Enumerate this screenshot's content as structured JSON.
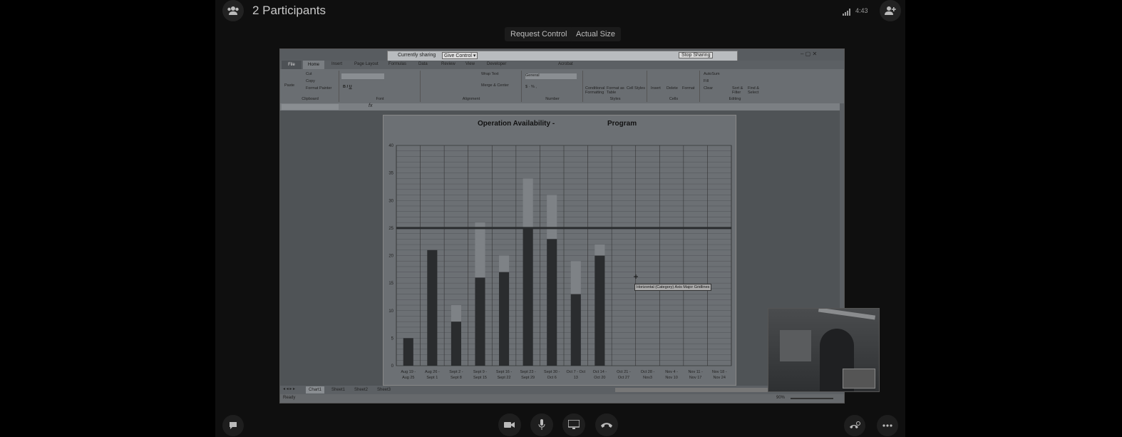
{
  "header": {
    "participants_label": "2 Participants",
    "time": "4:43",
    "participants_icon": "people-icon",
    "add_person_icon": "add-person-icon"
  },
  "toolbar": {
    "request_control": "Request Control",
    "actual_size": "Actual Size"
  },
  "share_bar": {
    "currently_sharing": "Currently sharing",
    "give_control": "Give Control ▾",
    "stop_sharing": "Stop Sharing"
  },
  "excel": {
    "tabs": [
      "File",
      "Home",
      "Insert",
      "Page Layout",
      "Formulas",
      "Data",
      "Review",
      "View",
      "Developer",
      "Acrobat"
    ],
    "groups": [
      "Clipboard",
      "Font",
      "Alignment",
      "Number",
      "Styles",
      "Cells",
      "Editing"
    ],
    "clipboard_items": [
      "Cut",
      "Copy",
      "Format Painter"
    ],
    "paste": "Paste",
    "wrap_text": "Wrap Text",
    "merge_center": "Merge & Center",
    "number_format": "General",
    "styles_items": [
      "Conditional Formatting",
      "Format as Table",
      "Cell Styles"
    ],
    "cells_items": [
      "Insert",
      "Delete",
      "Format"
    ],
    "editing_items": [
      "AutoSum",
      "Fill",
      "Clear",
      "Sort & Filter",
      "Find & Select"
    ],
    "sheet_tabs": [
      "Chart1",
      "Sheet1",
      "Sheet2",
      "Sheet3"
    ],
    "status_ready": "Ready",
    "zoom": "90%",
    "tooltip": "Horizontal (Category) Axis Major Gridlines"
  },
  "chart_data": {
    "type": "bar",
    "title_left": "Operation Availability -",
    "title_right": "Program",
    "categories": [
      [
        "Aug 19 -",
        "Aug 25"
      ],
      [
        "Aug 26 -",
        "Sept 1"
      ],
      [
        "Sept 2 -",
        "Sept 8"
      ],
      [
        "Sept 9 -",
        "Sept 15"
      ],
      [
        "Sept 16 -",
        "Sept 22"
      ],
      [
        "Sept 23 -",
        "Sept 29"
      ],
      [
        "Sept 30 -",
        "Oct 6"
      ],
      [
        "Oct 7 - Oct",
        "13"
      ],
      [
        "Oct 14 -",
        "Oct 20"
      ],
      [
        "Oct 21 -",
        "Oct 27"
      ],
      [
        "Oct 28 -",
        "Nov3"
      ],
      [
        "Nov 4 -",
        "Nov 10"
      ],
      [
        "Nov 11 -",
        "Nov 17"
      ],
      [
        "Nov 18 -",
        "Nov 24"
      ]
    ],
    "series": [
      {
        "values": [
          5,
          21,
          8,
          16,
          17,
          25,
          23,
          13,
          20,
          null,
          null,
          null,
          null,
          null
        ]
      },
      {
        "values": [
          0,
          0,
          3,
          10,
          3,
          9,
          8,
          6,
          2,
          null,
          null,
          null,
          null,
          null
        ]
      }
    ],
    "target_line": 25,
    "ylim": [
      0,
      40
    ],
    "yticks": [
      0,
      5,
      10,
      15,
      20,
      25,
      30,
      35,
      40
    ],
    "grid": true,
    "colors": {
      "bar": "#2a2c2e",
      "bar_upper": "#7e8286",
      "target": "#2a2c2e",
      "plot_bg": "#6c7074"
    }
  },
  "controls": {
    "chat_icon": "chat-icon",
    "camera_icon": "camera-icon",
    "mic_icon": "microphone-icon",
    "screen_icon": "screen-share-icon",
    "hangup_icon": "hang-up-icon",
    "call_settings_icon": "call-settings-icon",
    "more_icon": "more-icon"
  }
}
